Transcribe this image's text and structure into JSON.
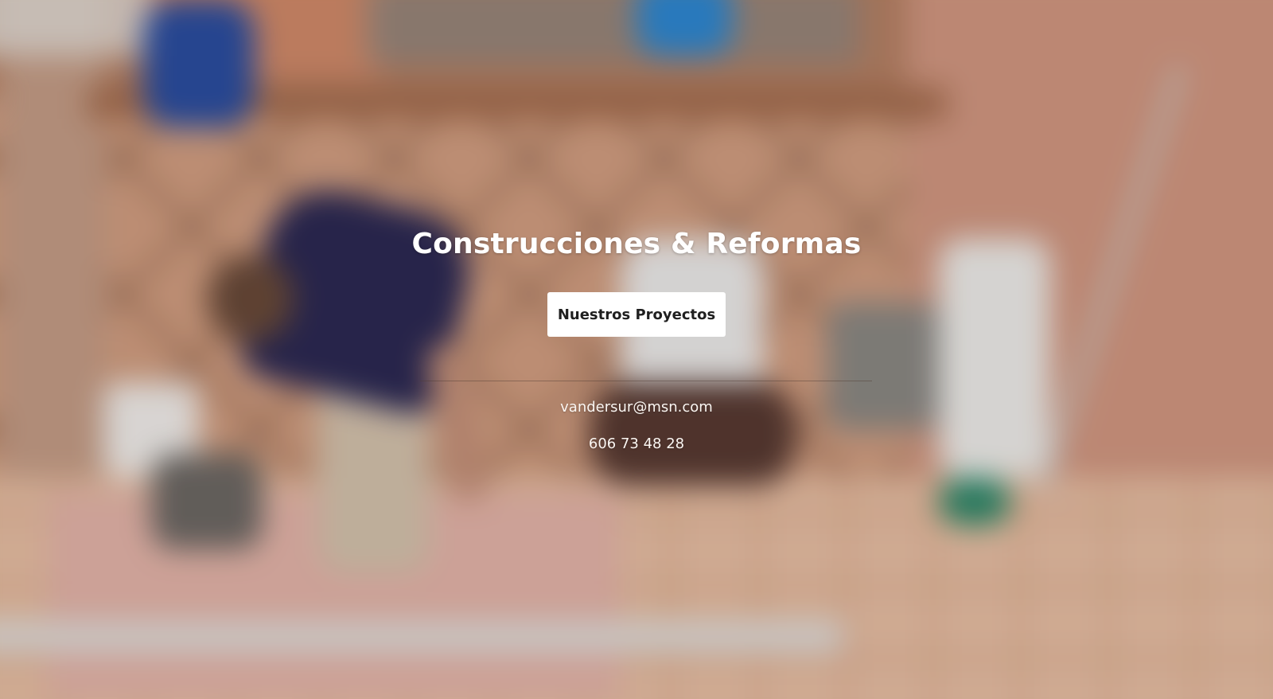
{
  "hero": {
    "title": "Construcciones & Reformas",
    "cta_label": "Nuestros Proyectos",
    "email": "vandersur@msn.com",
    "phone": "606 73 48 28",
    "background": "blurred-photo-of-workers-tiling-a-patio"
  }
}
